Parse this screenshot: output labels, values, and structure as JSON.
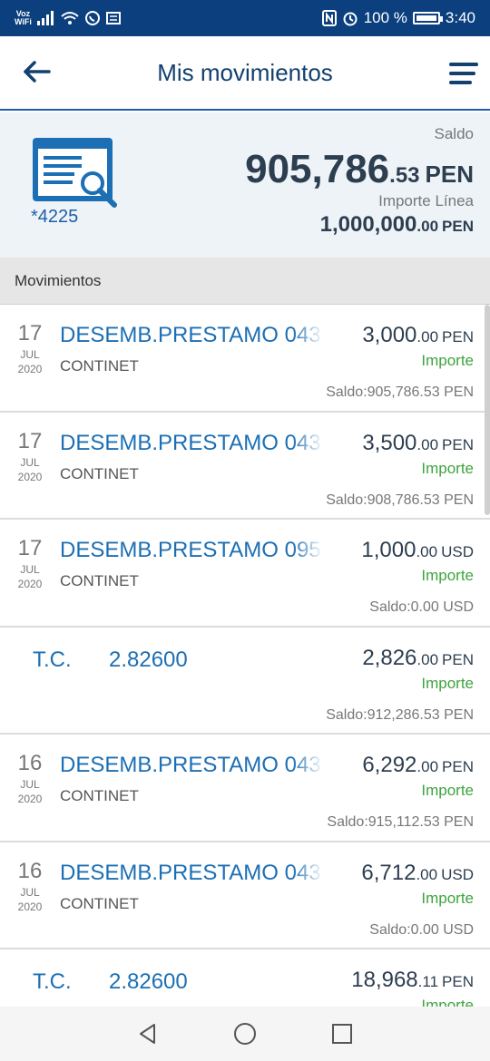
{
  "status_bar": {
    "voz": "Voz",
    "wifi": "WiFi",
    "battery_text": "100 %",
    "time": "3:40",
    "battery_level": 1.0
  },
  "header": {
    "title": "Mis movimientos",
    "back_icon": "arrow-left-icon",
    "menu_icon": "menu-icon"
  },
  "summary": {
    "account": "*4225",
    "saldo_label": "Saldo",
    "saldo_int": "905,786",
    "saldo_dec": ".53",
    "saldo_cur": "PEN",
    "linea_label": "Importe Línea",
    "linea_int": "1,000,000",
    "linea_dec": ".00",
    "linea_cur": "PEN"
  },
  "section": {
    "title": "Movimientos"
  },
  "colors": {
    "primary": "#0b3f7e",
    "link": "#1c6fb4",
    "positive": "#3ea43e"
  },
  "movements": [
    {
      "day": "17",
      "month": "JUL",
      "year": "2020",
      "desc": "DESEMB.PRESTAMO 043",
      "sub": "CONTINET",
      "amt_int": "3,000",
      "amt_dec": ".00",
      "cur": "PEN",
      "imp": "Importe",
      "bal": "Saldo:905,786.53 PEN"
    },
    {
      "day": "17",
      "month": "JUL",
      "year": "2020",
      "desc": "DESEMB.PRESTAMO 043",
      "sub": "CONTINET",
      "amt_int": "3,500",
      "amt_dec": ".00",
      "cur": "PEN",
      "imp": "Importe",
      "bal": "Saldo:908,786.53 PEN"
    },
    {
      "day": "17",
      "month": "JUL",
      "year": "2020",
      "desc": "DESEMB.PRESTAMO 095",
      "sub": "CONTINET",
      "amt_int": "1,000",
      "amt_dec": ".00",
      "cur": "USD",
      "imp": "Importe",
      "bal": "Saldo:0.00 USD"
    },
    {
      "tc_label": "T.C.",
      "tc_value": "2.82600",
      "amt_int": "2,826",
      "amt_dec": ".00",
      "cur": "PEN",
      "imp": "Importe",
      "bal": "Saldo:912,286.53 PEN"
    },
    {
      "day": "16",
      "month": "JUL",
      "year": "2020",
      "desc": "DESEMB.PRESTAMO 043",
      "sub": "CONTINET",
      "amt_int": "6,292",
      "amt_dec": ".00",
      "cur": "PEN",
      "imp": "Importe",
      "bal": "Saldo:915,112.53 PEN"
    },
    {
      "day": "16",
      "month": "JUL",
      "year": "2020",
      "desc": "DESEMB.PRESTAMO 043",
      "sub": "CONTINET",
      "amt_int": "6,712",
      "amt_dec": ".00",
      "cur": "USD",
      "imp": "Importe",
      "bal": "Saldo:0.00 USD"
    },
    {
      "tc_label": "T.C.",
      "tc_value": "2.82600",
      "amt_int": "18,968",
      "amt_dec": ".11",
      "cur": "PEN",
      "imp": "Importe",
      "bal": ""
    }
  ],
  "nav": {
    "back": "triangle-back-icon",
    "home": "circle-home-icon",
    "recent": "square-recent-icon"
  }
}
